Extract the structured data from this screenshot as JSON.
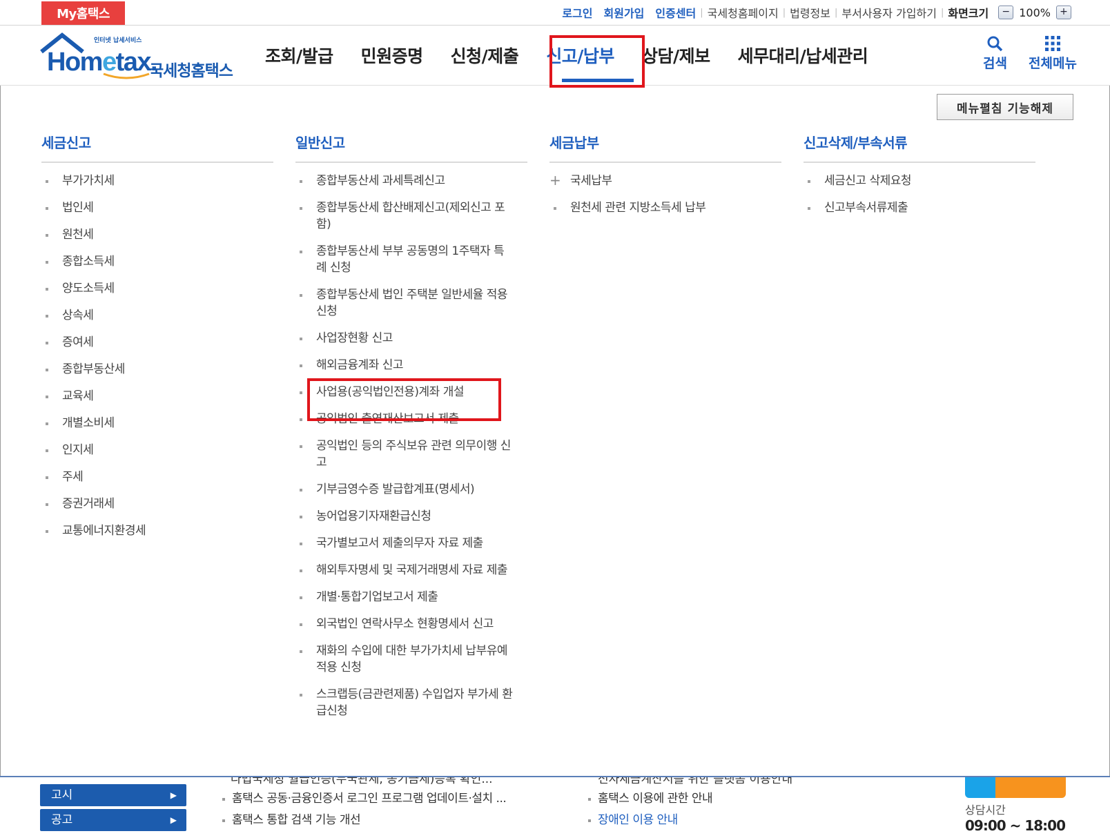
{
  "topbar": {
    "my_tab": "My홈택스",
    "login": "로그인",
    "signup": "회원가입",
    "cert_center": "인증센터",
    "nts_homepage": "국세청홈페이지",
    "law_info": "법령정보",
    "dept_user_signup": "부서사용자 가입하기",
    "screen_size": "화면크기",
    "zoom_minus": "−",
    "zoom_value": "100%",
    "zoom_plus": "+"
  },
  "header": {
    "logo_small": "인터넷 납세서비스",
    "logo_main_a": "Hom",
    "logo_main_e": "e",
    "logo_main_b": "tax.",
    "logo_sub": "국세청홈택스",
    "nav": [
      "조회/발급",
      "민원증명",
      "신청/제출",
      "신고/납부",
      "상담/제보",
      "세무대리/납세관리"
    ],
    "active_nav": "신고/납부",
    "search_label": "검색",
    "all_menu_label": "전체메뉴"
  },
  "panel": {
    "fold_button": "메뉴펼침 기능해제",
    "columns": [
      {
        "title": "세금신고",
        "items": [
          "부가가치세",
          "법인세",
          "원천세",
          "종합소득세",
          "양도소득세",
          "상속세",
          "증여세",
          "종합부동산세",
          "교육세",
          "개별소비세",
          "인지세",
          "주세",
          "증권거래세",
          "교통에너지환경세"
        ]
      },
      {
        "title": "일반신고",
        "items": [
          "종합부동산세 과세특례신고",
          "종합부동산세 합산배제신고(제외신고 포함)",
          "종합부동산세 부부 공동명의 1주택자 특례 신청",
          "종합부동산세 법인 주택분 일반세율 적용 신청",
          "사업장현황 신고",
          "해외금융계좌 신고",
          "사업용(공익법인전용)계좌 개설",
          "공익법인 출연재산보고서 제출",
          "공익법인 등의 주식보유 관련 의무이행 신고",
          "기부금영수증 발급합계표(명세서)",
          "농어업용기자재환급신청",
          "국가별보고서 제출의무자 자료 제출",
          "해외투자명세 및 국제거래명세 자료 제출",
          "개별·통합기업보고서 제출",
          "외국법인 연락사무소 현황명세서 신고",
          "재화의 수입에 대한 부가가치세 납부유예 적용 신청",
          "스크랩등(금관련제품) 수입업자 부가세 환급신청"
        ]
      },
      {
        "title": "세금납부",
        "items": [
          "국세납부",
          "원천세 관련 지방소득세 납부"
        ]
      },
      {
        "title": "신고삭제/부속서류",
        "items": [
          "세금신고 삭제요청",
          "신고부속서류제출"
        ]
      }
    ]
  },
  "bottom": {
    "side_buttons": [
      "고시",
      "공고"
    ],
    "notices": [
      "홈택스 공동·금융인증서 로그인 프로그램 업데이트·설치 ...",
      "홈택스 통합 검색 기능 개선"
    ],
    "notices_cut": "다법국세청 월급인증(무국관세, 농기금세)등록 확인...",
    "guides": [
      "홈택스 이용에 관한 안내",
      "장애인 이용 안내"
    ],
    "guides_cut": "전자세금계산서를 위한 플랫폼 이용안내",
    "consult_label": "상담시간",
    "consult_hours": "09:00 ~ 18:00"
  },
  "colors": {
    "brand_blue": "#1f5fbf",
    "highlight_red": "#e0161c",
    "my_tab_red": "#e8403e"
  }
}
